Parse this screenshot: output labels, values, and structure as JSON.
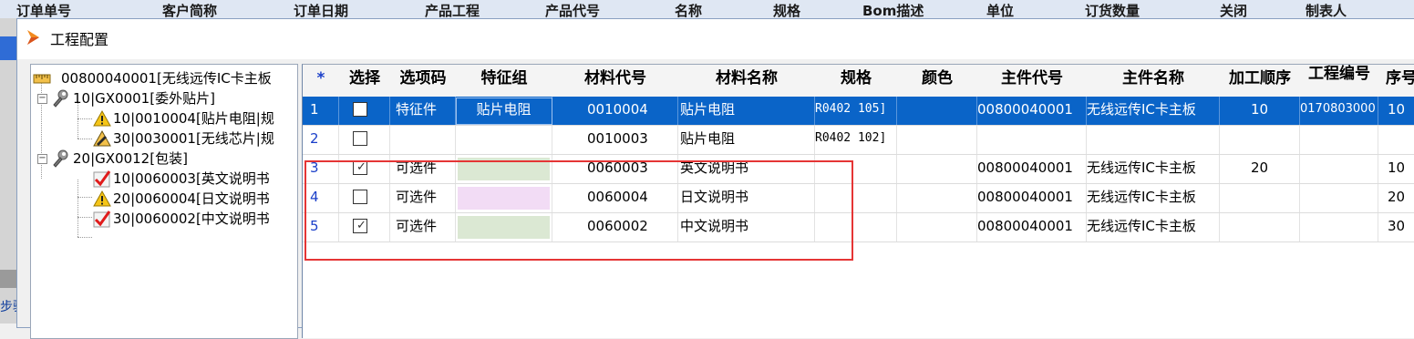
{
  "background": {
    "header_columns": [
      "订单单号",
      "客户简称",
      "订单日期",
      "产品工程",
      "产品代号",
      "名称",
      "规格",
      "Bom描述",
      "单位",
      "订货数量",
      "关闭",
      "制表人"
    ],
    "left_partial_text": "步骤"
  },
  "dialog": {
    "title": "工程配置"
  },
  "tree": {
    "nodes": [
      {
        "label": "00800040001[无线远传IC卡主板",
        "icon": "ruler-icon"
      },
      {
        "label": "10|GX0001[委外贴片]",
        "icon": "wrench-icon"
      },
      {
        "label": "10|0010004[贴片电阻|规",
        "icon": "warning-icon"
      },
      {
        "label": "30|0030001[无线芯片|规",
        "icon": "pen-tool-icon"
      },
      {
        "label": "20|GX0012[包装]",
        "icon": "wrench-icon"
      },
      {
        "label": "10|0060003[英文说明书",
        "icon": "check-mark-icon"
      },
      {
        "label": "20|0060004[日文说明书",
        "icon": "warning-icon"
      },
      {
        "label": "30|0060002[中文说明书",
        "icon": "check-mark-icon"
      }
    ]
  },
  "grid": {
    "columns": [
      "*",
      "选择",
      "选项码",
      "特征组",
      "材料代号",
      "材料名称",
      "规格",
      "颜色",
      "主件代号",
      "主件名称",
      "加工顺序",
      "工程编号",
      "序号"
    ],
    "rows": [
      {
        "num": "1",
        "checked": false,
        "option": "特征件",
        "feature": "贴片电阻",
        "feature_color": "",
        "code": "0010004",
        "name": "贴片电阻",
        "spec": "R0402 105]",
        "color": "",
        "parent_code": "00800040001",
        "parent_name": "无线远传IC卡主板",
        "order": "10",
        "project": "0170803000",
        "seq": "10",
        "selected": true
      },
      {
        "num": "2",
        "checked": false,
        "option": "",
        "feature": "",
        "feature_color": "",
        "code": "0010003",
        "name": "贴片电阻",
        "spec": "R0402 102]",
        "color": "",
        "parent_code": "",
        "parent_name": "",
        "order": "",
        "project": "",
        "seq": "",
        "selected": false
      },
      {
        "num": "3",
        "checked": true,
        "option": "可选件",
        "feature": "",
        "feature_color": "#dbe8d3",
        "code": "0060003",
        "name": "英文说明书",
        "spec": "",
        "color": "",
        "parent_code": "00800040001",
        "parent_name": "无线远传IC卡主板",
        "order": "20",
        "project": "",
        "seq": "10",
        "selected": false
      },
      {
        "num": "4",
        "checked": false,
        "option": "可选件",
        "feature": "",
        "feature_color": "#f2dcf5",
        "code": "0060004",
        "name": "日文说明书",
        "spec": "",
        "color": "",
        "parent_code": "00800040001",
        "parent_name": "无线远传IC卡主板",
        "order": "",
        "project": "",
        "seq": "20",
        "selected": false
      },
      {
        "num": "5",
        "checked": true,
        "option": "可选件",
        "feature": "",
        "feature_color": "#dbe8d3",
        "code": "0060002",
        "name": "中文说明书",
        "spec": "",
        "color": "",
        "parent_code": "00800040001",
        "parent_name": "无线远传IC卡主板",
        "order": "",
        "project": "",
        "seq": "30",
        "selected": false
      }
    ]
  },
  "colors": {
    "selection": "#0a64c8",
    "highlight_box": "#e53535",
    "row_number": "#1a3fc9"
  }
}
